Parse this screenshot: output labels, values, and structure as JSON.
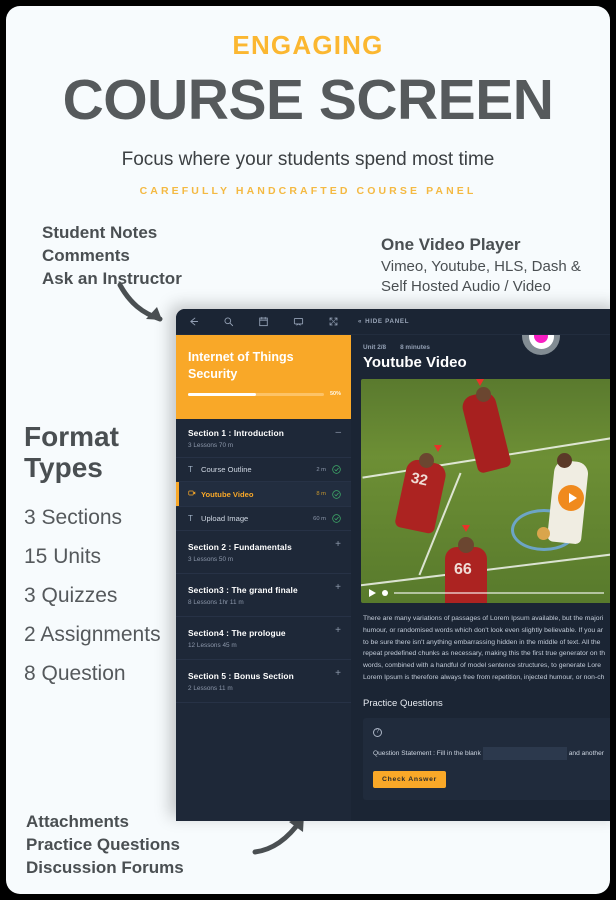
{
  "header": {
    "eyebrow": "ENGAGING",
    "title": "COURSE SCREEN",
    "subtitle": "Focus where your students spend most time",
    "kicker": "CAREFULLY HANDCRAFTED COURSE PANEL"
  },
  "annotations": {
    "top_left": [
      "Student Notes",
      "Comments",
      "Ask an Instructor"
    ],
    "top_right": {
      "heading": "One Video Player",
      "lines": [
        "Vimeo, Youtube, HLS, Dash &",
        "Self Hosted Audio / Video"
      ]
    },
    "bottom_left": [
      "Attachments",
      "Practice Questions",
      "Discussion Forums"
    ],
    "format": {
      "heading_line1": "Format",
      "heading_line2": "Types",
      "items": [
        "3 Sections",
        "15 Units",
        "3 Quizzes",
        "2 Assignments",
        "8 Question"
      ]
    }
  },
  "app": {
    "toolbar": {
      "icons": [
        "back-arrow-icon",
        "search-icon",
        "notes-icon",
        "comment-icon",
        "fullscreen-icon"
      ],
      "hide_panel_label": "HIDE PANEL",
      "hide_panel_chevron": "«"
    },
    "sidebar": {
      "course_title_line1": "Internet of Things",
      "course_title_line2": "Security",
      "progress_percent": "50%",
      "progress_value": 50,
      "sections": [
        {
          "title": "Section 1 : Introduction",
          "meta": "3 Lessons   70 m",
          "toggle": "–",
          "expanded": true,
          "lessons": [
            {
              "icon": "text-icon",
              "name": "Course Outline",
              "duration": "2 m",
              "complete": true,
              "active": false
            },
            {
              "icon": "video-icon",
              "name": "Youtube Video",
              "duration": "8 m",
              "complete": true,
              "active": true
            },
            {
              "icon": "text-icon",
              "name": "Upload Image",
              "duration": "60 m",
              "complete": true,
              "active": false
            }
          ]
        },
        {
          "title": "Section 2 : Fundamentals",
          "meta": "3 Lessons   50 m",
          "toggle": "+",
          "expanded": false,
          "lessons": []
        },
        {
          "title": "Section3 : The grand finale",
          "meta": "8 Lessons   1hr 11 m",
          "toggle": "+",
          "expanded": false,
          "lessons": []
        },
        {
          "title": "Section4 : The prologue",
          "meta": "12 Lessons   45 m",
          "toggle": "+",
          "expanded": false,
          "lessons": []
        },
        {
          "title": "Section 5 : Bonus Section",
          "meta": "2 Lessons   11 m",
          "toggle": "+",
          "expanded": false,
          "lessons": []
        }
      ]
    },
    "content": {
      "unit_label": "Unit 2/8",
      "unit_duration": "8 minutes",
      "unit_title": "Youtube Video",
      "paragraph_lines": [
        "There are many variations of passages of Lorem Ipsum available, but the majori",
        "humour, or randomised words which don't look even slightly believable. If you ar",
        "to be sure there isn't anything embarrassing hidden in the middle of text. All the",
        "repeat predefined chunks as necessary, making this the first true generator on th",
        "words, combined with a handful of model sentence structures, to generate Lore",
        "Lorem Ipsum is therefore always free from repetition, injected humour, or non-ch"
      ],
      "practice_heading": "Practice Questions",
      "question": {
        "help_icon": "?",
        "text_before": "Question Statement : Fill in the blank",
        "input_value": "",
        "input_placeholder": "",
        "text_after": "and another",
        "check_label": "Check Answer"
      }
    }
  },
  "colors": {
    "accent_orange": "#f9a828",
    "header_orange": "#fbb731",
    "panel_dark": "#1b2534",
    "sidebar_dark": "#1e2838",
    "cursor_pink": "#f81ec2",
    "complete_green": "#3fae6a",
    "title_gray": "#565a5c"
  }
}
